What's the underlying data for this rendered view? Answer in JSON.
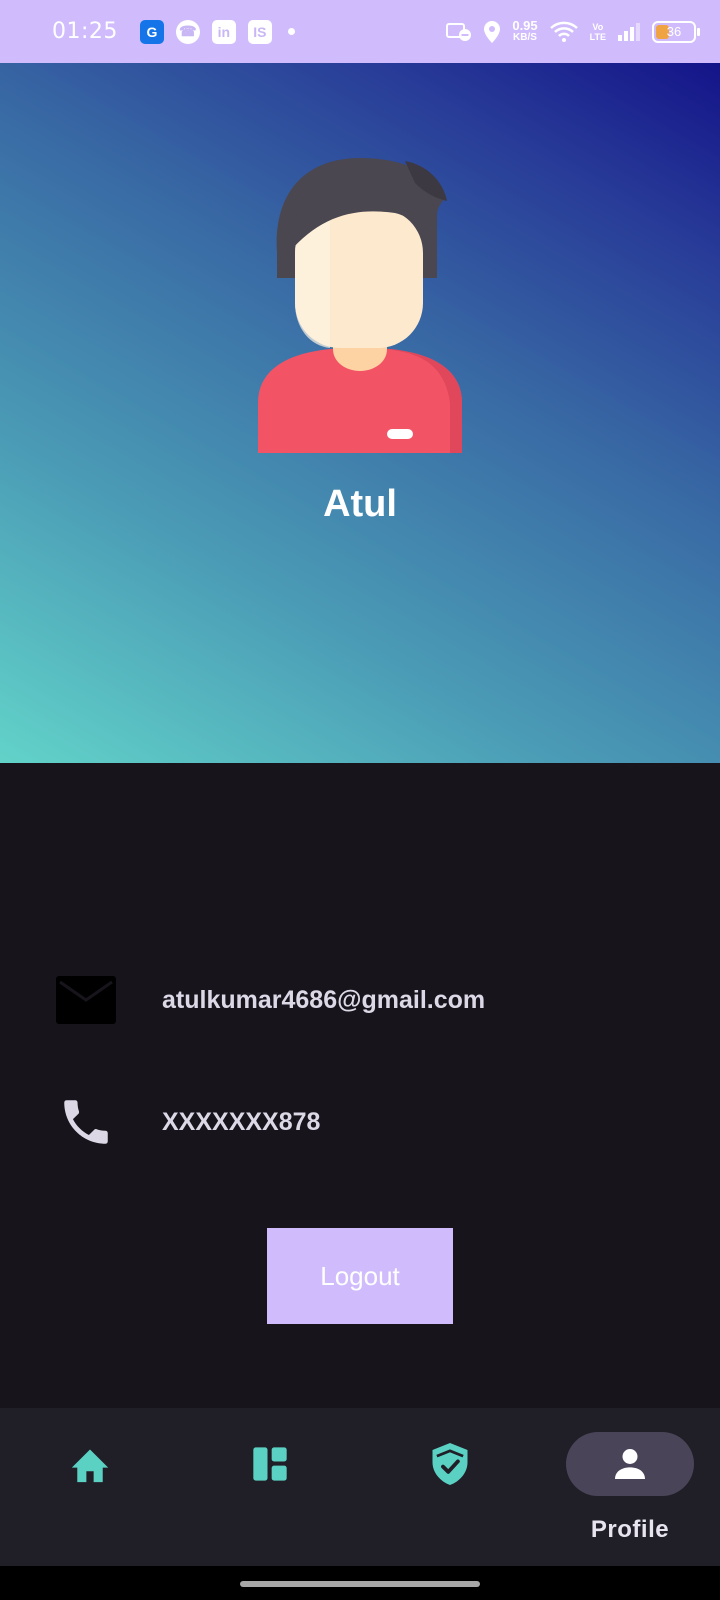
{
  "status_bar": {
    "time": "01:25",
    "notif_icons": [
      {
        "name": "wallet-icon",
        "glyph": "G"
      },
      {
        "name": "phone-app-icon",
        "glyph": "☎"
      },
      {
        "name": "linkedin-icon",
        "glyph": "in"
      },
      {
        "name": "is-app-icon",
        "glyph": "IS"
      }
    ],
    "speed_value": "0.95",
    "speed_unit": "KB/S",
    "volte_line1": "Vo",
    "volte_line2": "LTE",
    "battery_level": "36",
    "battery_fraction": 0.36
  },
  "profile": {
    "name": "Atul",
    "gradient_colors": [
      "#62d3c9",
      "#141489"
    ]
  },
  "contact": {
    "email": "atulkumar4686@gmail.com",
    "phone": "XXXXXXX878"
  },
  "actions": {
    "logout_label": "Logout"
  },
  "bottom_nav": {
    "items": [
      {
        "icon": "home-icon",
        "label": ""
      },
      {
        "icon": "dashboard-icon",
        "label": ""
      },
      {
        "icon": "shield-check-icon",
        "label": ""
      },
      {
        "icon": "person-icon",
        "label": "Profile",
        "active": true
      }
    ],
    "accent_color": "#5bd1c4"
  }
}
